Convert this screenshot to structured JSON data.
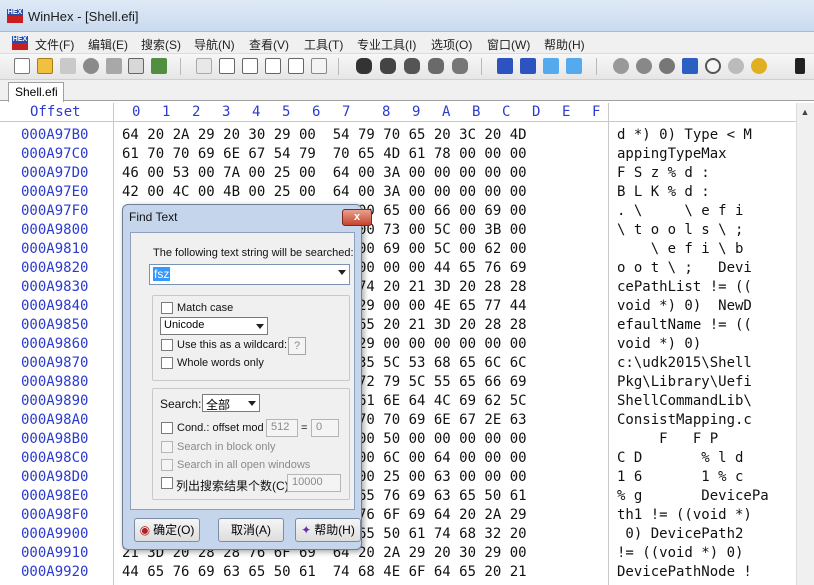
{
  "window": {
    "title": "WinHex - [Shell.efi]"
  },
  "menu": [
    "文件(F)",
    "编辑(E)",
    "搜索(S)",
    "导航(N)",
    "查看(V)",
    "工具(T)",
    "专业工具(I)",
    "选项(O)",
    "窗口(W)",
    "帮助(H)"
  ],
  "tab": {
    "label": "Shell.efi"
  },
  "hexview": {
    "offset_header": "Offset",
    "column_headers": [
      "0",
      "1",
      "2",
      "3",
      "4",
      "5",
      "6",
      "7",
      "8",
      "9",
      "A",
      "B",
      "C",
      "D",
      "E",
      "F"
    ],
    "rows": [
      {
        "offset": "000A97B0",
        "hex": "64 20 2A 29 20 30 29 00  54 79 70 65 20 3C 20 4D",
        "text": "d *) 0) Type < M"
      },
      {
        "offset": "000A97C0",
        "hex": "61 70 70 69 6E 67 54 79  70 65 4D 61 78 00 00 00",
        "text": "appingTypeMax"
      },
      {
        "offset": "000A97D0",
        "hex": "46 00 53 00 7A 00 25 00  64 00 3A 00 00 00 00 00",
        "text": "F S z % d :"
      },
      {
        "offset": "000A97E0",
        "hex": "42 00 4C 00 4B 00 25 00  64 00 3A 00 00 00 00 00",
        "text": "B L K % d :"
      },
      {
        "offset": "000A97F0",
        "hex": "                         5C 00 65 00 66 00 69 00",
        "text": ". \\     \\ e f i"
      },
      {
        "offset": "000A9800",
        "hex": "                         5C 00 73 00 5C 00 3B 00",
        "text": "\\ t o o l s \\ ;"
      },
      {
        "offset": "000A9810",
        "hex": "                         56 00 69 00 5C 00 62 00",
        "text": "    \\ e f i \\ b"
      },
      {
        "offset": "000A9820",
        "hex": "                         3B 00 00 00 44 65 76 69",
        "text": "o o t \\ ;   Devi"
      },
      {
        "offset": "000A9830",
        "hex": "                         73 74 20 21 3D 20 28 28",
        "text": "cePathList != (("
      },
      {
        "offset": "000A9840",
        "hex": "                         30 29 00 00 4E 65 77 44",
        "text": "void *) 0)  NewD"
      },
      {
        "offset": "000A9850",
        "hex": "                         5D 65 20 21 3D 20 28 28",
        "text": "efaultName != (("
      },
      {
        "offset": "000A9860",
        "hex": "                         30 29 00 00 00 00 00 00",
        "text": "void *) 0)"
      },
      {
        "offset": "000A9870",
        "hex": "                         31 35 5C 53 68 65 6C 6C",
        "text": "c:\\udk2015\\Shell"
      },
      {
        "offset": "000A9880",
        "hex": "                         51 72 79 5C 55 65 66 69",
        "text": "Pkg\\Library\\Uefi"
      },
      {
        "offset": "000A9890",
        "hex": "                         5D 61 6E 64 4C 69 62 5C",
        "text": "ShellCommandLib\\"
      },
      {
        "offset": "000A98A0",
        "hex": "                         51 70 70 69 6E 67 2E 63",
        "text": "ConsistMapping.c"
      },
      {
        "offset": "000A98B0",
        "hex": "                         46 00 50 00 00 00 00 00",
        "text": "     F   F P"
      },
      {
        "offset": "000A98C0",
        "hex": "                         25 00 6C 00 64 00 00 00",
        "text": "C D       % l d"
      },
      {
        "offset": "000A98D0",
        "hex": "                         31 00 25 00 63 00 00 00",
        "text": "1 6       1 % c"
      },
      {
        "offset": "000A98E0",
        "hex": "                         34 65 76 69 63 65 50 61",
        "text": "% g       DevicePa"
      },
      {
        "offset": "000A98F0",
        "hex": "                         28 76 6F 69 64 20 2A 29",
        "text": "th1 != ((void *)"
      },
      {
        "offset": "000A9900",
        "hex": "                         63 65 50 61 74 68 32 20",
        "text": " 0) DevicePath2"
      },
      {
        "offset": "000A9910",
        "hex": "21 3D 20 28 28 76 6F 69  64 20 2A 29 20 30 29 00",
        "text": "!= ((void *) 0)"
      },
      {
        "offset": "000A9920",
        "hex": "44 65 76 69 63 65 50 61  74 68 4E 6F 64 65 20 21",
        "text": "DevicePathNode !"
      }
    ]
  },
  "dialog": {
    "title": "Find Text",
    "close_glyph": "x",
    "prompt": "The following text string will be searched:",
    "search_value": "fsz",
    "match_case": "Match case",
    "encoding": "Unicode",
    "wildcard": "Use this as a wildcard:",
    "wildcard_char": "?",
    "whole_words": "Whole words only",
    "search_label": "Search:",
    "search_scope": "全部",
    "cond_offset": "Cond.: offset mod",
    "offset_mod": "512",
    "equals": "=",
    "offset_eq": "0",
    "search_block": "Search in block only",
    "search_all_windows": "Search in all open windows",
    "list_results": "列出搜索结果个数(C):",
    "result_limit": "10000",
    "ok_label": "确定(O)",
    "cancel_label": "取消(A)",
    "help_label": "帮助(H)"
  }
}
